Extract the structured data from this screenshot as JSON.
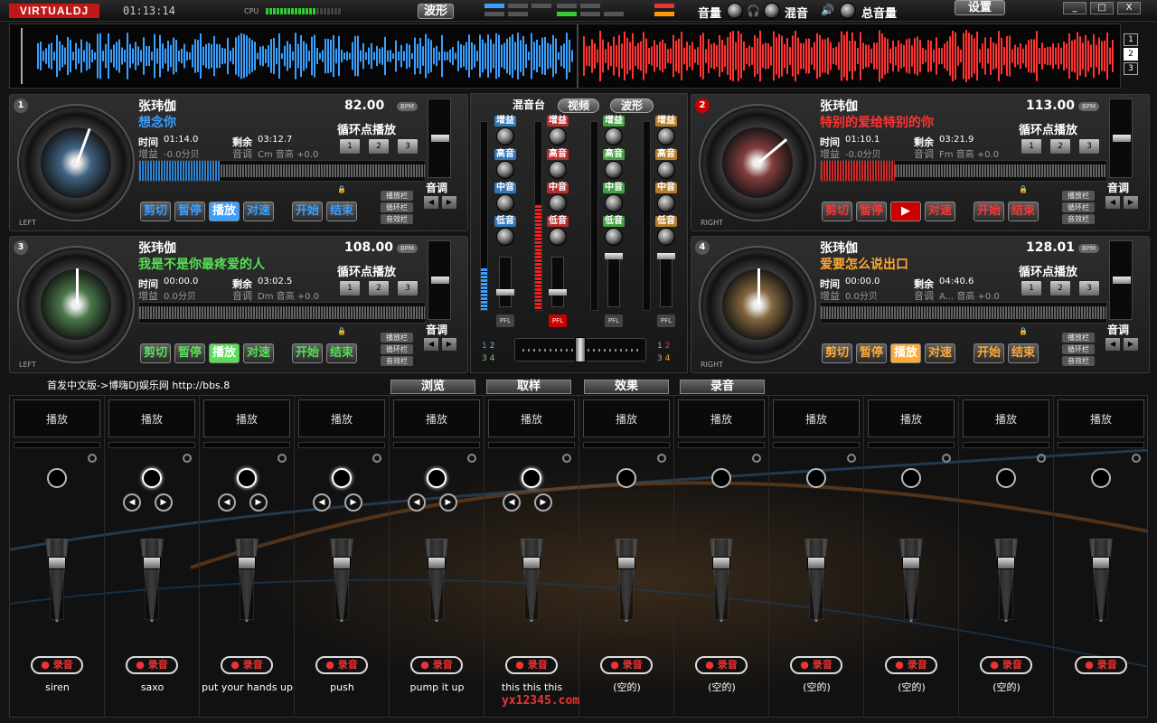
{
  "app": {
    "logo": "VIRTUALDJ",
    "clock": "01:13:14",
    "cpu_label": "CPU",
    "wave_button": "波形",
    "volume_label": "音量",
    "crossfader_label": "混音",
    "master_label": "总音量",
    "settings_button": "设置",
    "window_controls": [
      "_",
      "□",
      "X"
    ]
  },
  "overview": {
    "deck_selectors": [
      "1",
      "2",
      "3"
    ]
  },
  "decks": [
    {
      "number": "1",
      "side": "LEFT",
      "artist": "张玮伽",
      "title": "想念你",
      "title_color": "#3aa0ff",
      "bpm": "82.00",
      "bpm_tag": "BPM",
      "loop_label": "循环点播放",
      "loop_buttons": [
        "1",
        "2",
        "3"
      ],
      "time_label": "时间",
      "time": "01:14.0",
      "remain_label": "剩余",
      "remain": "03:12.7",
      "gain_label": "增益",
      "gain": "-0.0分贝",
      "key_label": "音调",
      "key": "Cm 音高 +0.0",
      "buttons": [
        "剪切",
        "暂停",
        "播放",
        "对速"
      ],
      "accent": "#3aa0ff",
      "start_label": "开始",
      "end_label": "结束",
      "tags": [
        "播放栏",
        "循环栏",
        "音效栏"
      ],
      "pitch_label": "音调"
    },
    {
      "number": "2",
      "side": "RIGHT",
      "artist": "张玮伽",
      "title": "特别的爱给特别的你",
      "title_color": "#ff3333",
      "bpm": "113.00",
      "bpm_tag": "BPM",
      "loop_label": "循环点播放",
      "loop_buttons": [
        "1",
        "2",
        "3"
      ],
      "time_label": "时间",
      "time": "01:10.1",
      "remain_label": "剩余",
      "remain": "03:21.9",
      "gain_label": "增益",
      "gain": "-0.0分贝",
      "key_label": "音调",
      "key": "Fm 音高 +0.0",
      "buttons": [
        "剪切",
        "暂停",
        "▶",
        "对速"
      ],
      "accent": "#ff3333",
      "start_label": "开始",
      "end_label": "结束",
      "tags": [
        "播放栏",
        "循环栏",
        "音效栏"
      ],
      "pitch_label": "音调"
    },
    {
      "number": "3",
      "side": "LEFT",
      "artist": "张玮伽",
      "title": "我是不是你最疼爱的人",
      "title_color": "#55e055",
      "bpm": "108.00",
      "bpm_tag": "BPM",
      "loop_label": "循环点播放",
      "loop_buttons": [
        "1",
        "2",
        "3"
      ],
      "time_label": "时间",
      "time": "00:00.0",
      "remain_label": "剩余",
      "remain": "03:02.5",
      "gain_label": "增益",
      "gain": "0.0分贝",
      "key_label": "音调",
      "key": "Dm 音高 +0.0",
      "buttons": [
        "剪切",
        "暂停",
        "播放",
        "对速"
      ],
      "accent": "#55e055",
      "start_label": "开始",
      "end_label": "结束",
      "tags": [
        "播放栏",
        "循环栏",
        "音效栏"
      ],
      "pitch_label": "音调"
    },
    {
      "number": "4",
      "side": "RIGHT",
      "artist": "张玮伽",
      "title": "爱要怎么说出口",
      "title_color": "#ffaa33",
      "bpm": "128.01",
      "bpm_tag": "BPM",
      "loop_label": "循环点播放",
      "loop_buttons": [
        "1",
        "2",
        "3"
      ],
      "time_label": "时间",
      "time": "00:00.0",
      "remain_label": "剩余",
      "remain": "04:40.6",
      "gain_label": "增益",
      "gain": "0.0分贝",
      "key_label": "音调",
      "key": "A... 音高 +0.0",
      "buttons": [
        "剪切",
        "暂停",
        "播放",
        "对速"
      ],
      "accent": "#ffaa33",
      "start_label": "开始",
      "end_label": "结束",
      "tags": [
        "播放栏",
        "循环栏",
        "音效栏"
      ],
      "pitch_label": "音调"
    }
  ],
  "mixer": {
    "tabs": [
      "混音台",
      "视频",
      "波形"
    ],
    "channels": [
      {
        "color": "#3aa0ff",
        "gain": "增益",
        "high": "高音",
        "mid": "中音",
        "low": "低音",
        "pfl": "PFL"
      },
      {
        "color": "#ff3333",
        "gain": "增益",
        "high": "高音",
        "mid": "中音",
        "low": "低音",
        "pfl": "PFL"
      },
      {
        "color": "#55e055",
        "gain": "增益",
        "high": "高音",
        "mid": "中音",
        "low": "低音",
        "pfl": "PFL"
      },
      {
        "color": "#ffaa33",
        "gain": "增益",
        "high": "高音",
        "mid": "中音",
        "low": "低音",
        "pfl": "PFL"
      }
    ],
    "xfader_left": [
      "1",
      "2",
      "3",
      "4"
    ],
    "xfader_right": [
      "1",
      "2",
      "3",
      "4"
    ]
  },
  "credit": "首发中文版->博嗨DJ娱乐网 http://bbs.8",
  "bottom_tabs": [
    "浏览",
    "取样",
    "效果",
    "录音"
  ],
  "sampler": {
    "play_label": "播放",
    "rec_label": "● 录音",
    "slots": [
      "siren",
      "saxo",
      "put your hands up",
      "push",
      "pump it up",
      "this this this",
      "(空的)",
      "(空的)",
      "(空的)",
      "(空的)",
      "(空的)",
      ""
    ]
  },
  "watermark": "yx12345.com"
}
